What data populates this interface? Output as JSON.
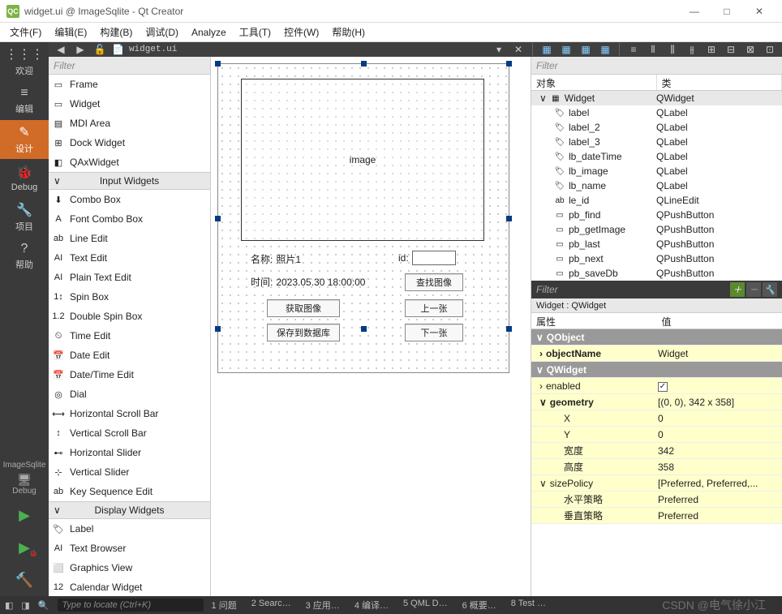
{
  "window": {
    "title": "widget.ui @ ImageSqlite - Qt Creator",
    "min": "—",
    "max": "□",
    "close": "✕"
  },
  "menu": [
    "文件(F)",
    "编辑(E)",
    "构建(B)",
    "调试(D)",
    "Analyze",
    "工具(T)",
    "控件(W)",
    "帮助(H)"
  ],
  "sidebar": {
    "items": [
      {
        "icon": "⋮⋮⋮",
        "label": "欢迎"
      },
      {
        "icon": "≡",
        "label": "编辑"
      },
      {
        "icon": "✎",
        "label": "设计"
      },
      {
        "icon": "🐞",
        "label": "Debug"
      },
      {
        "icon": "🔧",
        "label": "项目"
      },
      {
        "icon": "?",
        "label": "帮助"
      }
    ],
    "project": "ImageSqlite",
    "config": "Debug",
    "run": "▶",
    "runAlt": "▶",
    "build": "🔨"
  },
  "toolbar": {
    "filename": "widget.ui",
    "close": "✕"
  },
  "widgetbox": {
    "filter": "Filter",
    "items1": [
      {
        "icon": "▭",
        "label": "Frame"
      },
      {
        "icon": "▭",
        "label": "Widget"
      },
      {
        "icon": "▤",
        "label": "MDI Area"
      },
      {
        "icon": "⊞",
        "label": "Dock Widget"
      },
      {
        "icon": "◧",
        "label": "QAxWidget"
      }
    ],
    "cat1": "Input Widgets",
    "items2": [
      {
        "icon": "⬇",
        "label": "Combo Box"
      },
      {
        "icon": "A",
        "label": "Font Combo Box"
      },
      {
        "icon": "ab",
        "label": "Line Edit"
      },
      {
        "icon": "AI",
        "label": "Text Edit"
      },
      {
        "icon": "AI",
        "label": "Plain Text Edit"
      },
      {
        "icon": "1↕",
        "label": "Spin Box"
      },
      {
        "icon": "1.2",
        "label": "Double Spin Box"
      },
      {
        "icon": "⏲",
        "label": "Time Edit"
      },
      {
        "icon": "📅",
        "label": "Date Edit"
      },
      {
        "icon": "📅",
        "label": "Date/Time Edit"
      },
      {
        "icon": "◎",
        "label": "Dial"
      },
      {
        "icon": "⟷",
        "label": "Horizontal Scroll Bar"
      },
      {
        "icon": "↕",
        "label": "Vertical Scroll Bar"
      },
      {
        "icon": "⊷",
        "label": "Horizontal Slider"
      },
      {
        "icon": "⊹",
        "label": "Vertical Slider"
      },
      {
        "icon": "ab",
        "label": "Key Sequence Edit"
      }
    ],
    "cat2": "Display Widgets",
    "items3": [
      {
        "icon": "🏷",
        "label": "Label"
      },
      {
        "icon": "AI",
        "label": "Text Browser"
      },
      {
        "icon": "⬜",
        "label": "Graphics View"
      },
      {
        "icon": "12",
        "label": "Calendar Widget"
      }
    ]
  },
  "designer": {
    "image_label": "image",
    "name_lbl": "名称:",
    "name_val": "照片1",
    "id_lbl": "id:",
    "time_lbl": "时间:",
    "time_val": "2023.05.30 18:00:00",
    "btn_find": "查找图像",
    "btn_get": "获取图像",
    "btn_prev": "上一张",
    "btn_save": "保存到数据库",
    "btn_next": "下一张"
  },
  "objtree": {
    "filter": "Filter",
    "h1": "对象",
    "h2": "类",
    "rows": [
      {
        "d": 0,
        "exp": "∨",
        "icon": "▦",
        "name": "Widget",
        "cls": "QWidget",
        "sel": true
      },
      {
        "d": 1,
        "icon": "🏷",
        "name": "label",
        "cls": "QLabel"
      },
      {
        "d": 1,
        "icon": "🏷",
        "name": "label_2",
        "cls": "QLabel"
      },
      {
        "d": 1,
        "icon": "🏷",
        "name": "label_3",
        "cls": "QLabel"
      },
      {
        "d": 1,
        "icon": "🏷",
        "name": "lb_dateTime",
        "cls": "QLabel"
      },
      {
        "d": 1,
        "icon": "🏷",
        "name": "lb_image",
        "cls": "QLabel"
      },
      {
        "d": 1,
        "icon": "🏷",
        "name": "lb_name",
        "cls": "QLabel"
      },
      {
        "d": 1,
        "icon": "ab",
        "name": "le_id",
        "cls": "QLineEdit"
      },
      {
        "d": 1,
        "icon": "▭",
        "name": "pb_find",
        "cls": "QPushButton"
      },
      {
        "d": 1,
        "icon": "▭",
        "name": "pb_getImage",
        "cls": "QPushButton"
      },
      {
        "d": 1,
        "icon": "▭",
        "name": "pb_last",
        "cls": "QPushButton"
      },
      {
        "d": 1,
        "icon": "▭",
        "name": "pb_next",
        "cls": "QPushButton"
      },
      {
        "d": 1,
        "icon": "▭",
        "name": "pb_saveDb",
        "cls": "QPushButton"
      }
    ]
  },
  "props": {
    "filter": "Filter",
    "context": "Widget : QWidget",
    "h1": "属性",
    "h2": "值",
    "rows": [
      {
        "g": 1,
        "n": "QObject"
      },
      {
        "y": 1,
        "b": 1,
        "n": "objectName",
        "v": "Widget",
        "exp": ""
      },
      {
        "g": 1,
        "n": "QWidget"
      },
      {
        "y": 1,
        "n": "enabled",
        "v": "[chk]",
        "exp": ""
      },
      {
        "y": 1,
        "b": 1,
        "n": "geometry",
        "v": "[(0, 0), 342 x 358]",
        "exp": "∨"
      },
      {
        "y": 1,
        "n": "X",
        "v": "0",
        "ind": 1
      },
      {
        "y": 1,
        "n": "Y",
        "v": "0",
        "ind": 1
      },
      {
        "y": 1,
        "n": "宽度",
        "v": "342",
        "ind": 1
      },
      {
        "y": 1,
        "n": "高度",
        "v": "358",
        "ind": 1
      },
      {
        "y": 1,
        "n": "sizePolicy",
        "v": "[Preferred, Preferred,...",
        "exp": "∨"
      },
      {
        "y": 1,
        "n": "水平策略",
        "v": "Preferred",
        "ind": 1
      },
      {
        "y": 1,
        "n": "垂直策略",
        "v": "Preferred",
        "ind": 1
      }
    ]
  },
  "status": {
    "search": "Type to locate (Ctrl+K)",
    "items": [
      "1  问题",
      "2  Searc…",
      "3  应用…",
      "4  编译…",
      "5  QML D…",
      "6  概要…",
      "8  Test …"
    ],
    "watermark": "CSDN @电气徐小江"
  }
}
